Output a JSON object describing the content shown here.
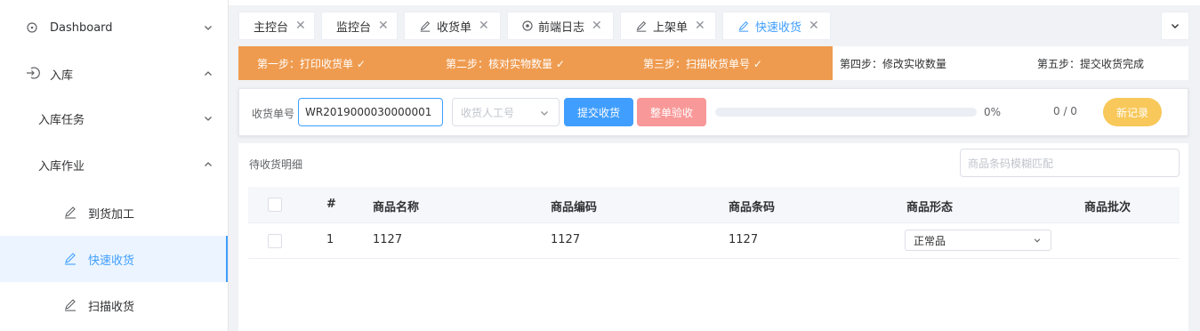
{
  "sidebar": {
    "items": [
      {
        "label": "Dashboard",
        "icon": "clock-icon",
        "arrow": "down"
      },
      {
        "label": "入库",
        "icon": "signin-icon",
        "arrow": "up"
      },
      {
        "label": "入库任务",
        "arrow": "down"
      },
      {
        "label": "入库作业",
        "arrow": "up"
      },
      {
        "label": "到货加工",
        "icon": "pen-icon"
      },
      {
        "label": "快速收货",
        "icon": "pen-icon",
        "active": true
      },
      {
        "label": "扫描收货",
        "icon": "pen-icon"
      }
    ]
  },
  "tabs": [
    {
      "label": "主控台"
    },
    {
      "label": "监控台"
    },
    {
      "label": "收货单",
      "icon": "pen-icon"
    },
    {
      "label": "前端日志",
      "icon": "target-icon"
    },
    {
      "label": "上架单",
      "icon": "pen-icon"
    },
    {
      "label": "快速收货",
      "icon": "pen-icon",
      "active": true
    }
  ],
  "steps": [
    {
      "label": "第一步：打印收货单 ✓",
      "done": true
    },
    {
      "label": "第二步：核对实物数量 ✓",
      "done": true
    },
    {
      "label": "第三步：扫描收货单号 ✓",
      "done": true
    },
    {
      "label": "第四步：修改实收数量",
      "done": false
    },
    {
      "label": "第五步：提交收货完成",
      "done": false
    }
  ],
  "form": {
    "receipt_label": "收货单号",
    "receipt_value": "WR2019000030000001",
    "worker_placeholder": "收货人工号",
    "submit_label": "提交收货",
    "check_label": "整单验收",
    "progress_percent": 0,
    "progress_text": "0%",
    "count_text": "0 / 0",
    "new_label": "新记录"
  },
  "detail": {
    "title": "待收货明细",
    "search_placeholder": "商品条码模糊匹配",
    "columns": [
      "#",
      "商品名称",
      "商品编码",
      "商品条码",
      "商品形态",
      "商品批次"
    ],
    "rows": [
      {
        "index": "1",
        "name": "1127",
        "code": "1127",
        "barcode": "1127",
        "form": "正常品",
        "batch": ""
      }
    ]
  },
  "colors": {
    "accent": "#409eff",
    "step_done": "#ef9b4f",
    "check_btn": "#f89898",
    "new_btn": "#f8c85a"
  }
}
